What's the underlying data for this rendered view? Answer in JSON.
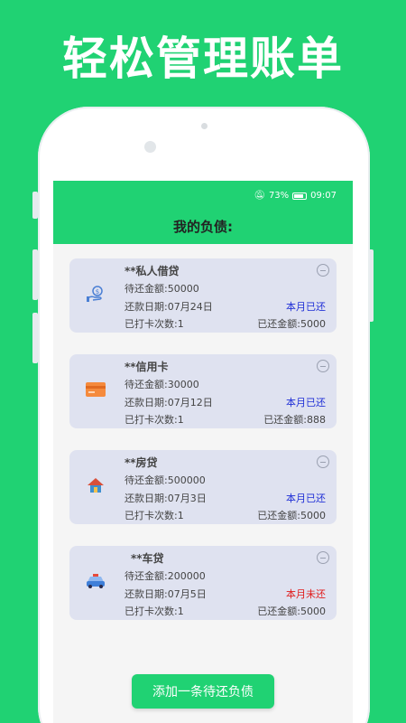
{
  "headline": "轻松管理账单",
  "status_bar": {
    "battery": "73%",
    "time": "09:07"
  },
  "page_title": "我的负债:",
  "labels": {
    "due_amount": "待还金额:",
    "repay_date": "还款日期:",
    "checkin_count": "已打卡次数:",
    "paid_amount": "已还金额:"
  },
  "debts": [
    {
      "name": "**私人借贷",
      "due": "50000",
      "date": "07月24日",
      "status": "本月已还",
      "count": "1",
      "paid": "5000",
      "icon": "money-hand-icon"
    },
    {
      "name": "**信用卡",
      "due": "30000",
      "date": "07月12日",
      "status": "本月已还",
      "count": "1",
      "paid": "888",
      "icon": "credit-card-icon"
    },
    {
      "name": "**房贷",
      "due": "500000",
      "date": "07月3日",
      "status": "本月已还",
      "count": "1",
      "paid": "5000",
      "icon": "house-icon"
    },
    {
      "name": "**车贷",
      "due": "200000",
      "date": "07月5日",
      "status": "本月未还",
      "count": "1",
      "paid": "5000",
      "icon": "car-icon"
    }
  ],
  "add_button": "添加一条待还负债",
  "colors": {
    "brand": "#20d273",
    "paid_status": "#1f2fd6",
    "unpaid_status": "#e01a1a",
    "card_bg": "#dfe2f0"
  }
}
